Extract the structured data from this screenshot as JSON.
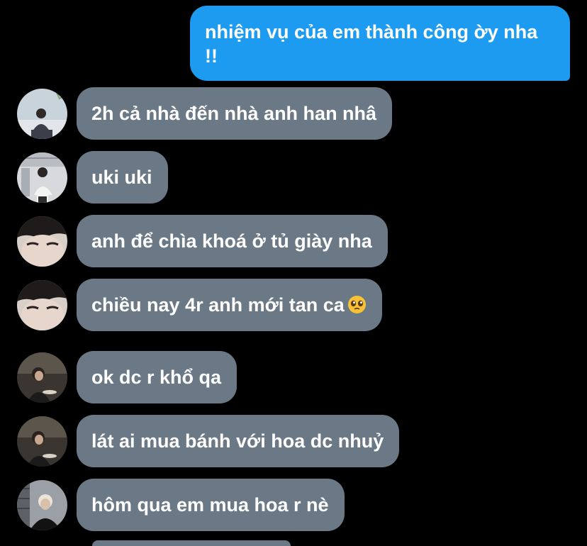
{
  "conversation": {
    "outgoing": [
      {
        "text": "nhiệm vụ của em thành công ờy nha !!"
      }
    ],
    "incoming": [
      {
        "text": "2h cả nhà đến nhà anh han nhâ",
        "avatar": "avatar-person-1"
      },
      {
        "text": "uki uki",
        "avatar": "avatar-person-2"
      },
      {
        "text": "anh để chìa khoá ở tủ giày nha",
        "avatar": "avatar-person-3"
      },
      {
        "text": "chiều nay 4r anh mới tan ca",
        "avatar": "avatar-person-3",
        "emoji": "pleading-face-emoji"
      },
      {
        "text": "ok dc r khổ qa",
        "avatar": "avatar-person-4"
      },
      {
        "text": "lát ai mua bánh với hoa dc nhuỷ",
        "avatar": "avatar-person-4"
      },
      {
        "text": "hôm qua em mua hoa r nè",
        "avatar": "avatar-person-5"
      }
    ]
  },
  "colors": {
    "background": "#000000",
    "outgoing_bubble": "#1d9bf0",
    "incoming_bubble": "#6b7886",
    "text": "#ffffff"
  }
}
